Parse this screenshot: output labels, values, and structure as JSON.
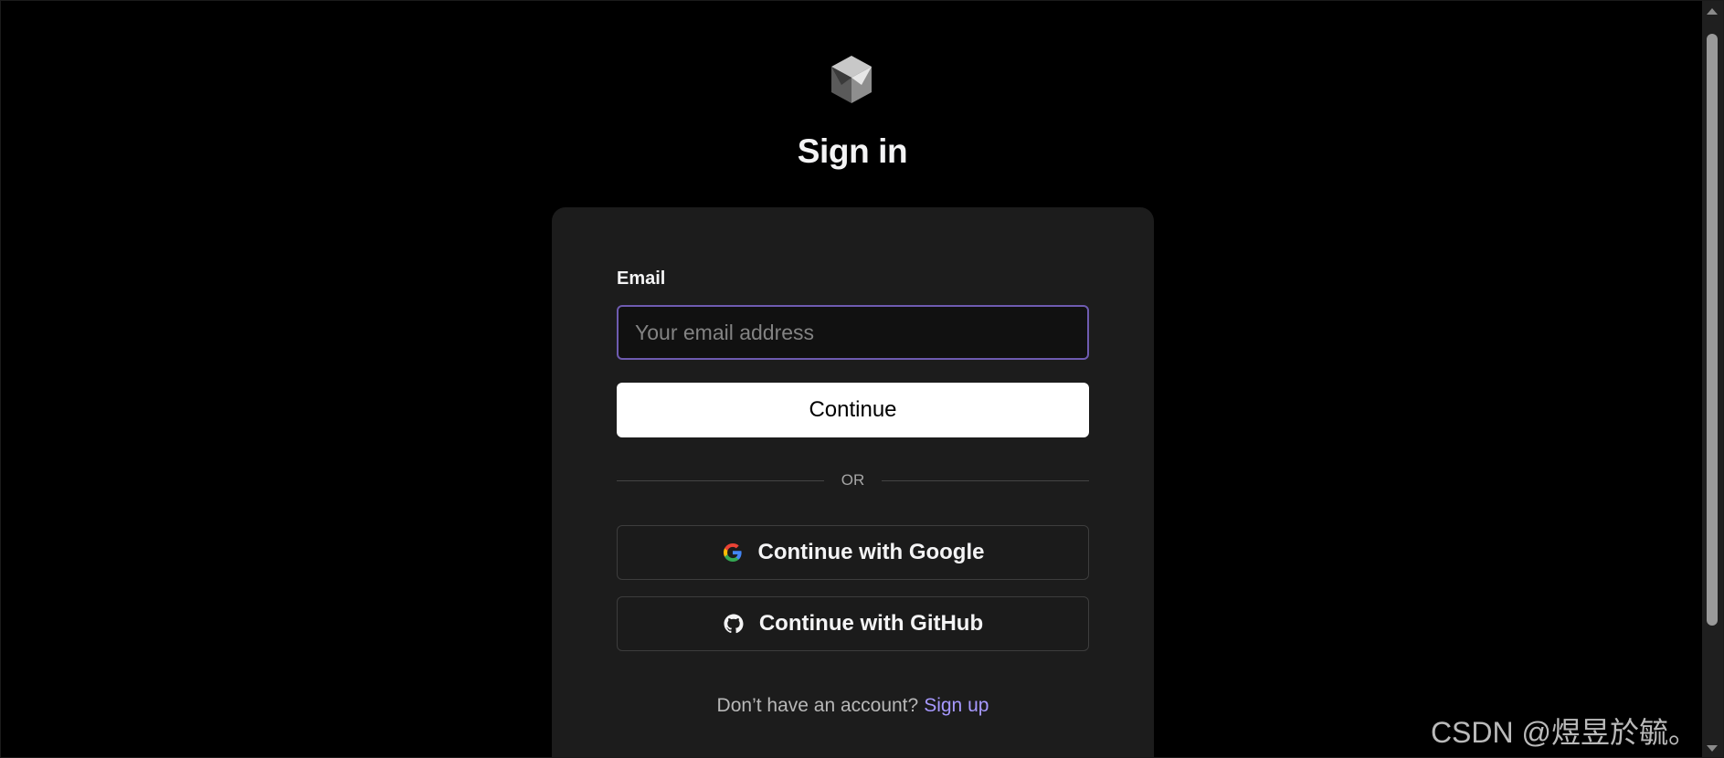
{
  "page": {
    "title": "Sign in"
  },
  "form": {
    "email_label": "Email",
    "email_placeholder": "Your email address",
    "email_value": "",
    "continue_label": "Continue",
    "divider_text": "OR"
  },
  "oauth": {
    "google_label": "Continue with Google",
    "github_label": "Continue with GitHub",
    "google_icon": "google-g-icon",
    "github_icon": "github-octocat-icon"
  },
  "footer": {
    "prompt": "Don’t have an account?",
    "signup_label": "Sign up"
  },
  "watermark": {
    "text": "CSDN @煜昱於毓。"
  },
  "colors": {
    "background": "#000000",
    "card": "#1c1c1c",
    "input_focus_border": "#6e5bb0",
    "link": "#a799ff",
    "primary_button": "#ffffff"
  }
}
